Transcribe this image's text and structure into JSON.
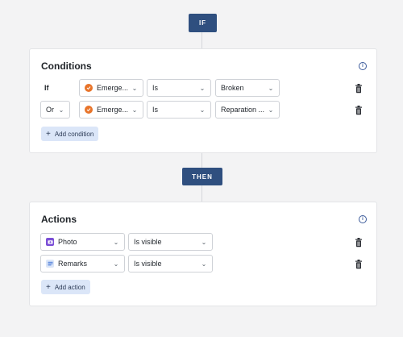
{
  "if_label": "IF",
  "then_label": "THEN",
  "conditions": {
    "title": "Conditions",
    "rows": [
      {
        "operator": "If",
        "field": "Emerge...",
        "comparison": "Is",
        "value": "Broken"
      },
      {
        "operator": "Or",
        "field": "Emerge...",
        "comparison": "Is",
        "value": "Reparation ..."
      }
    ],
    "add_label": "Add condition"
  },
  "actions": {
    "title": "Actions",
    "rows": [
      {
        "field": "Photo",
        "state": "Is visible"
      },
      {
        "field": "Remarks",
        "state": "Is visible"
      }
    ],
    "add_label": "Add action"
  },
  "colors": {
    "accent": "#2f4f7f",
    "field_icon_orange": "#e8742a",
    "photo_icon": "#7b4fd6",
    "remarks_icon": "#3b6fd6"
  }
}
